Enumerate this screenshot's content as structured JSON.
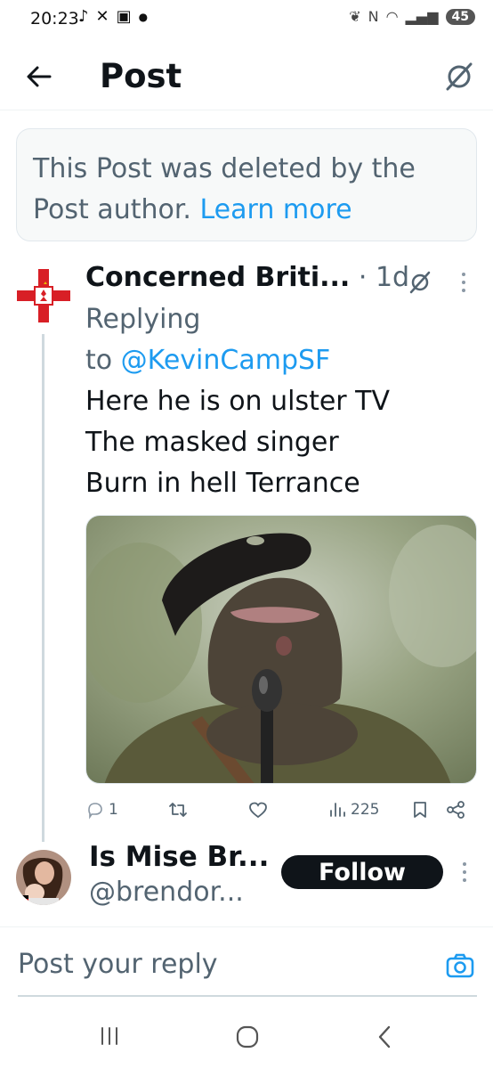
{
  "status_bar": {
    "time": "20:23",
    "left_icons": [
      "tiktok-icon",
      "x-icon",
      "notification-icon",
      "dot-icon"
    ],
    "battery": "45"
  },
  "header": {
    "title": "Post"
  },
  "deleted_notice": {
    "text": "This Post was deleted by the Post author. ",
    "link": "Learn more"
  },
  "tweet": {
    "author": "Concerned Briti...",
    "separator": "·",
    "age": "1d",
    "replying_prefix": "Replying",
    "replying_to_word": "to ",
    "replying_handle": "@KevinCampSF",
    "body_lines": [
      "Here he is on ulster TV",
      "The masked singer",
      "Burn in hell Terrance"
    ],
    "replies": "1",
    "views": "225"
  },
  "user": {
    "name": "Is Mise Br...",
    "handle": "@brendor...",
    "follow_label": "Follow"
  },
  "composer": {
    "placeholder": "Post your reply"
  },
  "colors": {
    "accent": "#1d9bf0",
    "text": "#0f1419",
    "muted": "#536471"
  }
}
